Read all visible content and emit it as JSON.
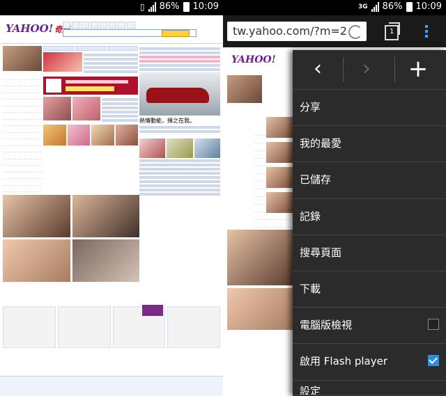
{
  "left_status": {
    "percent": "86%",
    "time": "10:09"
  },
  "right_status": {
    "network": "3G",
    "percent": "86%",
    "time": "10:09"
  },
  "left_page": {
    "logo": "YAHOO!",
    "logo_suffix": "奇摩",
    "car_ad_text": "熱情動能，揮之在我。"
  },
  "browser": {
    "url": "tw.yahoo.com/?m=2",
    "tabs_count": "1"
  },
  "menu": {
    "back_label": "‹",
    "forward_label": "›",
    "new_tab_label": "+",
    "items": [
      {
        "label": "分享"
      },
      {
        "label": "我的最愛"
      },
      {
        "label": "已儲存"
      },
      {
        "label": "記錄"
      },
      {
        "label": "搜尋頁面"
      },
      {
        "label": "下載"
      },
      {
        "label": "電腦版檢視",
        "checked": false
      },
      {
        "label": "啟用 Flash player",
        "checked": true
      },
      {
        "label": "設定"
      }
    ]
  }
}
